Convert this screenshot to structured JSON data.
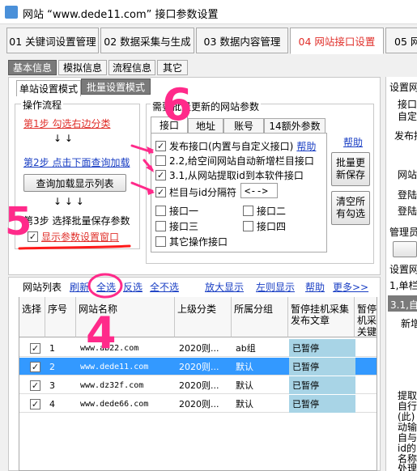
{
  "window": {
    "title": "网站 “www.dede11.com” 接口参数设置"
  },
  "main_tabs": [
    {
      "label": "01 关键词设置管理"
    },
    {
      "label": "02 数据采集与生成"
    },
    {
      "label": "03 数据内容管理"
    },
    {
      "label": "04 网站接口设置"
    },
    {
      "label": "05 网"
    }
  ],
  "sub_tabs": [
    {
      "label": "基本信息"
    },
    {
      "label": "模拟信息"
    },
    {
      "label": "流程信息"
    },
    {
      "label": "其它"
    }
  ],
  "mode_tabs": [
    {
      "label": "单站设置模式"
    },
    {
      "label": "批量设置模式"
    }
  ],
  "flow": {
    "title": "操作流程",
    "step1": "第1步 勾选右边分类",
    "arrows1": "↓  ↓",
    "step2": "第2步 点击下面查询加载",
    "load_button": "查询加载显示列表",
    "arrows2": "↓  ↓  ↓",
    "step3": "第3步 选择批量保存参数",
    "show_params": "显示参数设置窗口"
  },
  "batch": {
    "title": "需要批量更新的网站参数",
    "tabs": [
      {
        "label": "接口"
      },
      {
        "label": "地址"
      },
      {
        "label": "账号"
      },
      {
        "label": "14额外参数"
      }
    ],
    "help": "帮助",
    "options": {
      "publish": "发布接口(内置与自定义接口)",
      "publish_help": "帮助",
      "opt_22": "2.2,给空间网站自动新增栏目接口",
      "opt_31": "3.1,从网站提取id到本软件接口",
      "column_id_sep": "栏目与id分隔符",
      "sep_value": "<-->",
      "if1": "接口一",
      "if2": "接口二",
      "if3": "接口三",
      "if4": "接口四",
      "other": "其它操作接口"
    },
    "save_button": "批量更新保存",
    "clear_button": "清空所有勾选"
  },
  "right_panel": {
    "lines": [
      "设置网",
      "接口",
      "自定义",
      "发布接",
      "网站",
      "登陆",
      "登陆",
      "管理员",
      "设置网",
      "1,单栏",
      "3.1,自",
      "新增",
      "提取",
      "自行",
      "(此)",
      "动输",
      "自与",
      "id的",
      "名称",
      "处理"
    ]
  },
  "list": {
    "title": "网站列表",
    "links": [
      "刷新",
      "全选",
      "反选",
      "全不选",
      "放大显示",
      "左则显示",
      "帮助",
      "更多>>"
    ],
    "columns": [
      "选择",
      "序号",
      "网站名称",
      "上级分类",
      "所属分组",
      "暂停挂机采集发布文章",
      "暂停机采关键"
    ],
    "rows": [
      {
        "checked": true,
        "no": "1",
        "site": "www.ab22.com",
        "parent": "2020则...",
        "group": "ab组",
        "status": "已暂停"
      },
      {
        "checked": true,
        "no": "2",
        "site": "www.dede11.com",
        "parent": "2020则...",
        "group": "默认",
        "status": "已暂停"
      },
      {
        "checked": true,
        "no": "3",
        "site": "www.dz32f.com",
        "parent": "2020则...",
        "group": "默认",
        "status": "已暂停"
      },
      {
        "checked": true,
        "no": "4",
        "site": "www.dede66.com",
        "parent": "2020则...",
        "group": "默认",
        "status": "已暂停"
      }
    ]
  },
  "annotations": {
    "n6": "6",
    "n5": "5",
    "n4": "4"
  },
  "colors": {
    "active_tab": "#e0302b",
    "annotation": "#ff2a8a",
    "selected_row": "#3399ff",
    "paused_cell": "#a8d4e6"
  }
}
